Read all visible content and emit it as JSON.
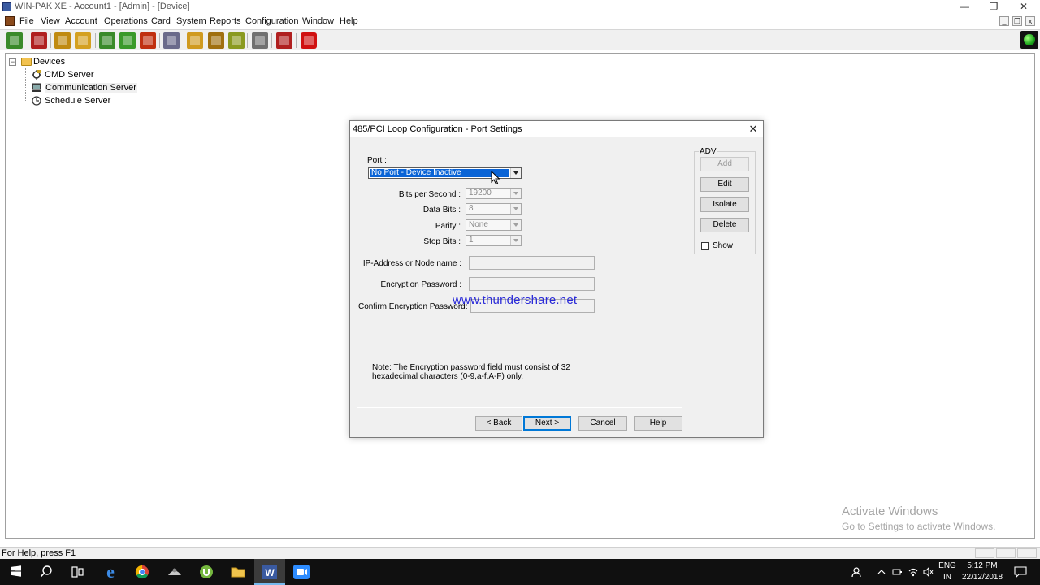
{
  "window": {
    "title": "WIN-PAK XE - Account1 - [Admin] - [Device]",
    "controls": {
      "minimize": "—",
      "restore": "❐",
      "close": "✕"
    }
  },
  "menubar": {
    "items": [
      "File",
      "View",
      "Account",
      "Operations",
      "Card",
      "System",
      "Reports",
      "Configuration",
      "Window",
      "Help"
    ],
    "mdi_controls": {
      "minimize": "_",
      "restore": "❐",
      "close": "x"
    }
  },
  "toolbar": {
    "buttons": [
      {
        "icon": "check-book-icon",
        "color": "#3a8a2a"
      },
      {
        "icon": "film-icon",
        "color": "#b02020"
      },
      {
        "icon": "list-icon",
        "color": "#c08a10"
      },
      {
        "icon": "pencil-note-icon",
        "color": "#d4a020"
      },
      {
        "icon": "folder-tree-icon",
        "color": "#3a8a2a"
      },
      {
        "icon": "map-icon",
        "color": "#3a9a2a"
      },
      {
        "icon": "building-icon",
        "color": "#c03010"
      },
      {
        "icon": "people-icon",
        "color": "#6a6a8a"
      },
      {
        "icon": "folder-open-icon",
        "color": "#d09a20"
      },
      {
        "icon": "door-icon",
        "color": "#a07010"
      },
      {
        "icon": "report-icon",
        "color": "#8a9a20"
      },
      {
        "icon": "stack-icon",
        "color": "#707070"
      },
      {
        "icon": "compass-icon",
        "color": "#b02020"
      },
      {
        "icon": "stop-icon",
        "color": "#d01010"
      }
    ]
  },
  "tree": {
    "root": "Devices",
    "children": [
      "CMD Server",
      "Communication Server",
      "Schedule Server"
    ]
  },
  "dialog": {
    "title": "485/PCI Loop Configuration - Port Settings",
    "port_label": "Port :",
    "port_value": "No Port - Device Inactive",
    "bps_label": "Bits per Second :",
    "bps_value": "19200",
    "databits_label": "Data Bits :",
    "databits_value": "8",
    "parity_label": "Parity :",
    "parity_value": "None",
    "stopbits_label": "Stop Bits :",
    "stopbits_value": "1",
    "ip_label": "IP-Address or Node name :",
    "encpw_label": "Encryption Password :",
    "confirm_label": "Confirm Encryption Password:",
    "note": "Note: The Encryption password field must consist of 32 hexadecimal characters (0-9,a-f,A-F) only.",
    "adv_legend": "ADV",
    "adv_buttons": {
      "add": "Add",
      "edit": "Edit",
      "isolate": "Isolate",
      "delete": "Delete"
    },
    "show_label": "Show",
    "footer_buttons": {
      "back": "< Back",
      "next": "Next >",
      "cancel": "Cancel",
      "help": "Help"
    }
  },
  "overlay_text": "www.thundershare.net",
  "activation": {
    "title": "Activate Windows",
    "subtitle": "Go to Settings to activate Windows."
  },
  "statusbar": {
    "text": "For Help, press F1"
  },
  "taskbar": {
    "language_top": "ENG",
    "language_bottom": "IN",
    "time": "5:12 PM",
    "date": "22/12/2018",
    "accent": "#76b9ed"
  }
}
